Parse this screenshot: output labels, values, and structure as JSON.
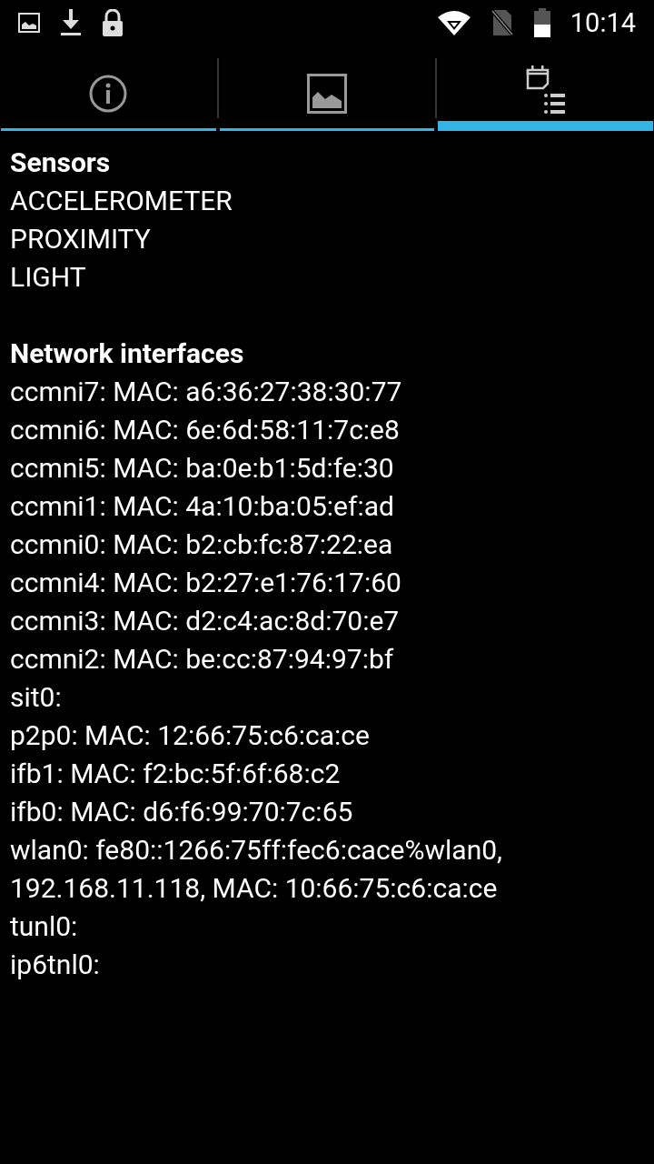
{
  "status_bar": {
    "time": "10:14"
  },
  "tabs": [
    {
      "kind": "info",
      "selected": false
    },
    {
      "kind": "image",
      "selected": false
    },
    {
      "kind": "sensors",
      "selected": true
    }
  ],
  "sections": [
    {
      "title": "Sensors",
      "lines": [
        "ACCELEROMETER",
        "PROXIMITY",
        "LIGHT"
      ]
    },
    {
      "title": "Network interfaces",
      "lines": [
        "ccmni7: MAC: a6:36:27:38:30:77",
        "ccmni6: MAC: 6e:6d:58:11:7c:e8",
        "ccmni5: MAC: ba:0e:b1:5d:fe:30",
        "ccmni1: MAC: 4a:10:ba:05:ef:ad",
        "ccmni0: MAC: b2:cb:fc:87:22:ea",
        "ccmni4: MAC: b2:27:e1:76:17:60",
        "ccmni3: MAC: d2:c4:ac:8d:70:e7",
        "ccmni2: MAC: be:cc:87:94:97:bf",
        "sit0:",
        "p2p0: MAC: 12:66:75:c6:ca:ce",
        "ifb1: MAC: f2:bc:5f:6f:68:c2",
        "ifb0: MAC: d6:f6:99:70:7c:65",
        "wlan0: fe80::1266:75ff:fec6:cace%wlan0, 192.168.11.118, MAC: 10:66:75:c6:ca:ce",
        "tunl0:",
        "ip6tnl0:"
      ]
    }
  ]
}
